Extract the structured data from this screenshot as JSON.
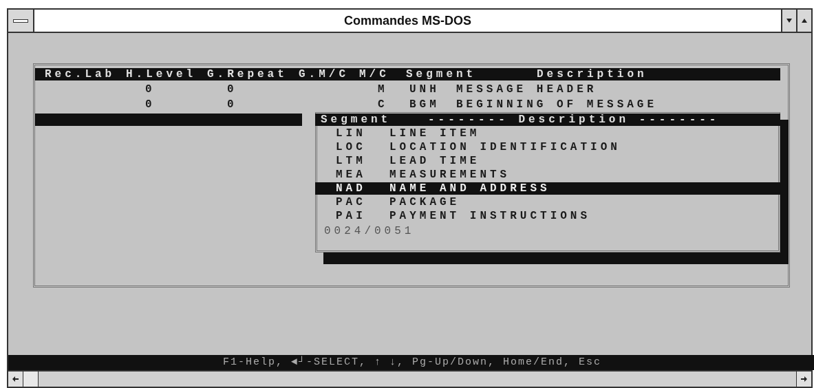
{
  "window": {
    "title": "Commandes MS-DOS"
  },
  "table": {
    "columns": [
      "Rec.Lab",
      "H.Level",
      "G.Repeat",
      "G.M/C",
      "M/C",
      "Segment",
      "Description"
    ],
    "rows": [
      {
        "h_level": "0",
        "g_repeat": "0",
        "m_c": "M",
        "segment": "UNH",
        "description": "MESSAGE HEADER"
      },
      {
        "h_level": "0",
        "g_repeat": "0",
        "m_c": "C",
        "segment": "BGM",
        "description": "BEGINNING OF MESSAGE"
      }
    ]
  },
  "segment_list": {
    "header_segment": "Segment",
    "header_description": "-------- Description --------",
    "items": [
      {
        "segment": "LIN",
        "description": "LINE ITEM",
        "selected": false
      },
      {
        "segment": "LOC",
        "description": "LOCATION IDENTIFICATION",
        "selected": false
      },
      {
        "segment": "LTM",
        "description": "LEAD TIME",
        "selected": false
      },
      {
        "segment": "MEA",
        "description": "MEASUREMENTS",
        "selected": false
      },
      {
        "segment": "NAD",
        "description": "NAME AND ADDRESS",
        "selected": true
      },
      {
        "segment": "PAC",
        "description": "PACKAGE",
        "selected": false
      },
      {
        "segment": "PAI",
        "description": "PAYMENT INSTRUCTIONS",
        "selected": false
      }
    ],
    "counter": "0024/0051"
  },
  "status_bar": "F1-Help, ◄┘-SELECT, ↑ ↓, Pg-Up/Down, Home/End, Esc"
}
